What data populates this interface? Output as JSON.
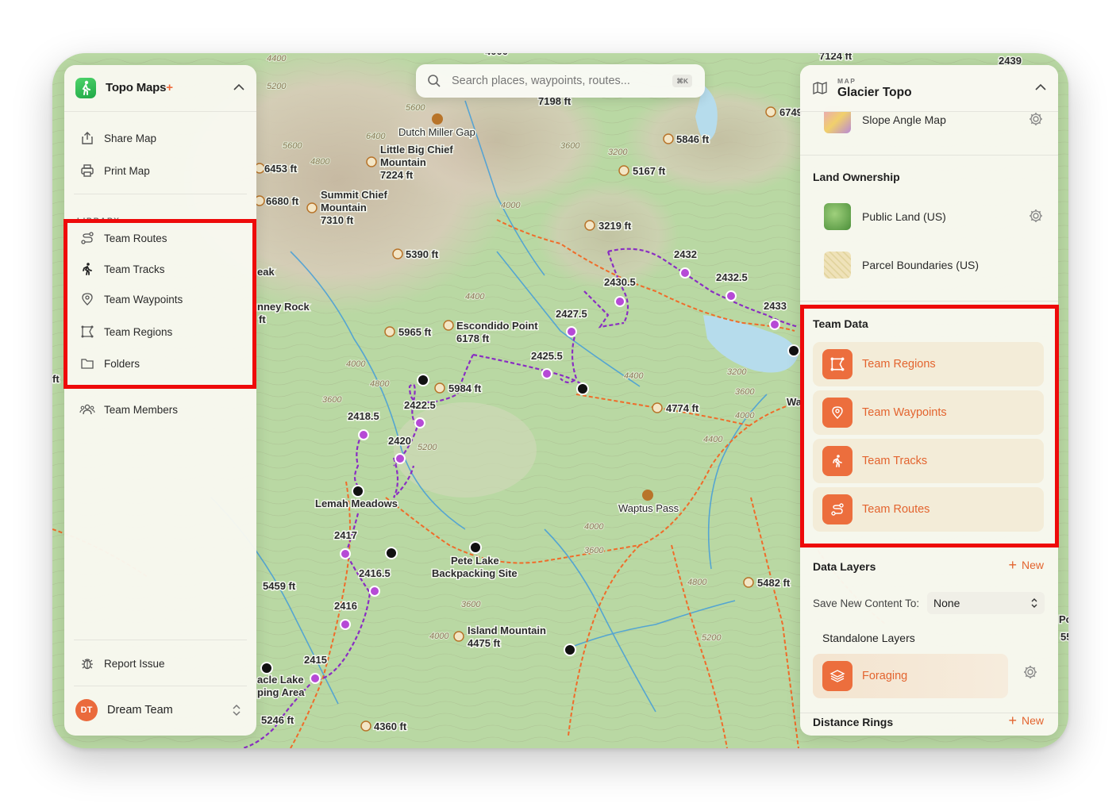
{
  "app": {
    "title": "Topo Maps",
    "title_plus": "+",
    "brand_color": "#ec6e3d"
  },
  "left_panel": {
    "actions": [
      {
        "label": "Share Map",
        "icon": "share-icon"
      },
      {
        "label": "Print Map",
        "icon": "printer-icon"
      }
    ],
    "library_label": "LIBRARY",
    "library_items": [
      {
        "label": "Team Routes",
        "icon": "route-icon"
      },
      {
        "label": "Team Tracks",
        "icon": "hiker-icon"
      },
      {
        "label": "Team Waypoints",
        "icon": "pin-icon"
      },
      {
        "label": "Team Regions",
        "icon": "region-icon"
      },
      {
        "label": "Folders",
        "icon": "folder-icon"
      }
    ],
    "members_label": "Team Members",
    "report_label": "Report Issue",
    "team": {
      "initials": "DT",
      "name": "Dream Team"
    }
  },
  "search": {
    "placeholder": "Search places, waypoints, routes...",
    "shortcut": "⌘K"
  },
  "right_panel": {
    "kicker": "MAP",
    "title": "Glacier Topo",
    "base_layers": [
      {
        "label": "Slope Angle Map"
      }
    ],
    "land_ownership": {
      "title": "Land Ownership",
      "items": [
        {
          "label": "Public Land (US)"
        },
        {
          "label": "Parcel Boundaries (US)"
        }
      ]
    },
    "team_data": {
      "title": "Team Data",
      "items": [
        {
          "label": "Team Regions",
          "icon": "region-icon"
        },
        {
          "label": "Team Waypoints",
          "icon": "pin-icon"
        },
        {
          "label": "Team Tracks",
          "icon": "hiker-icon"
        },
        {
          "label": "Team Routes",
          "icon": "route-icon"
        }
      ]
    },
    "data_layers": {
      "title": "Data Layers",
      "new_label": "New",
      "save_label": "Save New Content To:",
      "save_value": "None",
      "standalone_label": "Standalone Layers",
      "foraging_label": "Foraging"
    },
    "distance_rings": {
      "title": "Distance Rings",
      "new_label": "New"
    }
  },
  "map": {
    "places": [
      "Dutch Miller Gap",
      "Little Big Chief",
      "Mountain",
      "7224 ft",
      "Summit Chief",
      "Mountain",
      "7310 ft",
      "Escondido Point",
      "6178 ft",
      "Lemah Meadows",
      "Pete Lake",
      "Backpacking Site",
      "Waptus Pass",
      "Island Mountain",
      "4475 ft",
      "acle Lake",
      "ping Area",
      "eak",
      "nney Rock"
    ],
    "elevations": [
      "7198 ft",
      "5846 ft",
      "5167 ft",
      "6453 ft",
      "6680 ft",
      "3219 ft",
      "5390 ft",
      "5965 ft",
      "5984 ft",
      "4774 ft",
      "5459 ft",
      "5482 ft",
      "5246 ft",
      "4360 ft",
      "6749",
      "7124 ft",
      "2439",
      "4000",
      "55",
      "ft",
      "ft",
      "Wa",
      "Po"
    ],
    "waypoints": [
      "2432",
      "2432.5",
      "2433",
      "2430.5",
      "2427.5",
      "2425.5",
      "2422.5",
      "2418.5",
      "2420",
      "2417",
      "2416.5",
      "2416",
      "2415"
    ],
    "contours": [
      "4400",
      "5200",
      "5600",
      "6400",
      "4800",
      "5600",
      "4000",
      "3600",
      "3200",
      "4400",
      "4000",
      "3600",
      "4800",
      "5200",
      "3600",
      "4000",
      "4400",
      "3600",
      "3200",
      "4000",
      "4400",
      "4800",
      "5200",
      "3600",
      "4000"
    ]
  }
}
